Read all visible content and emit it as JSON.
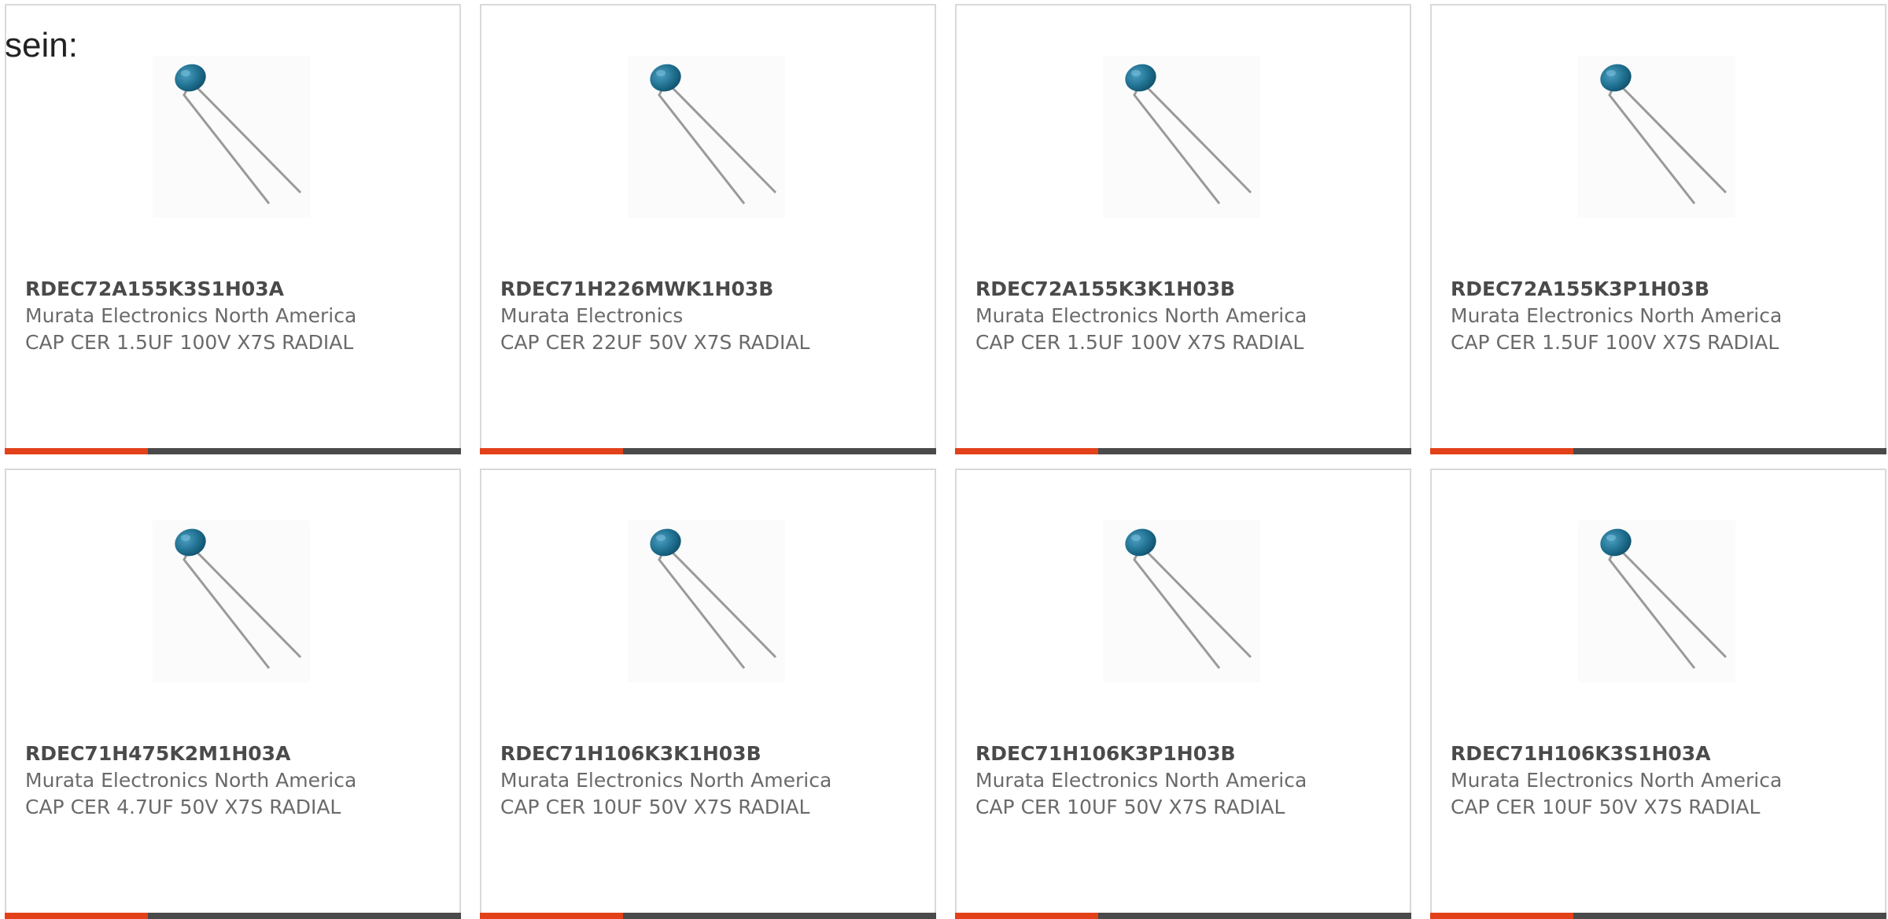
{
  "page": {
    "lead_text": "sein:"
  },
  "theme": {
    "accent_color": "#e2411a",
    "bar_color": "#4a4a4a",
    "body_color": "#1f6f8f",
    "lead_color": "#9a9a9a"
  },
  "products": [
    {
      "part_number": "RDEC72A155K3S1H03A",
      "manufacturer": "Murata Electronics North America",
      "description": "CAP CER 1.5UF 100V X7S RADIAL",
      "image_icon": "radial-capacitor-icon"
    },
    {
      "part_number": "RDEC71H226MWK1H03B",
      "manufacturer": "Murata Electronics",
      "description": "CAP CER 22UF 50V X7S RADIAL",
      "image_icon": "radial-capacitor-icon"
    },
    {
      "part_number": "RDEC72A155K3K1H03B",
      "manufacturer": "Murata Electronics North America",
      "description": "CAP CER 1.5UF 100V X7S RADIAL",
      "image_icon": "radial-capacitor-icon"
    },
    {
      "part_number": "RDEC72A155K3P1H03B",
      "manufacturer": "Murata Electronics North America",
      "description": "CAP CER 1.5UF 100V X7S RADIAL",
      "image_icon": "radial-capacitor-icon"
    },
    {
      "part_number": "RDEC71H475K2M1H03A",
      "manufacturer": "Murata Electronics North America",
      "description": "CAP CER 4.7UF 50V X7S RADIAL",
      "image_icon": "radial-capacitor-icon"
    },
    {
      "part_number": "RDEC71H106K3K1H03B",
      "manufacturer": "Murata Electronics North America",
      "description": "CAP CER 10UF 50V X7S RADIAL",
      "image_icon": "radial-capacitor-icon"
    },
    {
      "part_number": "RDEC71H106K3P1H03B",
      "manufacturer": "Murata Electronics North America",
      "description": "CAP CER 10UF 50V X7S RADIAL",
      "image_icon": "radial-capacitor-icon"
    },
    {
      "part_number": "RDEC71H106K3S1H03A",
      "manufacturer": "Murata Electronics North America",
      "description": "CAP CER 10UF 50V X7S RADIAL",
      "image_icon": "radial-capacitor-icon"
    }
  ]
}
